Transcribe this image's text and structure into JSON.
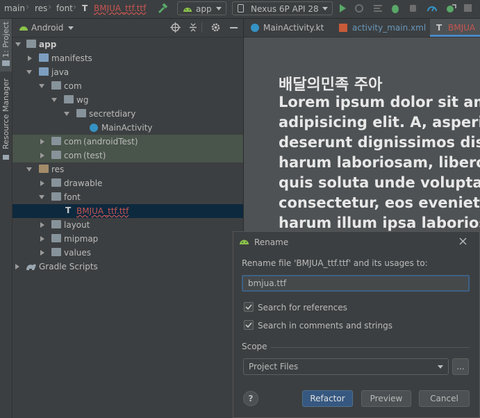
{
  "breadcrumb": {
    "items": [
      "main",
      "res",
      "font",
      "BMJUA_ttf.ttf"
    ]
  },
  "toolbar": {
    "run_config": "app",
    "device": "Nexus 6P API 28"
  },
  "left_strip": {
    "project_label": "1: Project",
    "resource_manager_label": "Resource Manager"
  },
  "project_panel": {
    "view_mode": "Android",
    "tree": [
      {
        "label": "app",
        "bold": true
      },
      {
        "label": "manifests"
      },
      {
        "label": "java"
      },
      {
        "label": "com"
      },
      {
        "label": "wg"
      },
      {
        "label": "secretdiary"
      },
      {
        "label": "MainActivity"
      },
      {
        "label": "com",
        "suffix": "(androidTest)"
      },
      {
        "label": "com",
        "suffix": "(test)"
      },
      {
        "label": "res"
      },
      {
        "label": "drawable"
      },
      {
        "label": "font"
      },
      {
        "label": "BMJUA_ttf.ttf"
      },
      {
        "label": "layout"
      },
      {
        "label": "mipmap"
      },
      {
        "label": "values"
      },
      {
        "label": "Gradle Scripts"
      }
    ]
  },
  "editor_tabs": [
    {
      "label": "MainActivity.kt"
    },
    {
      "label": "activity_main.xml"
    },
    {
      "label": "BMJUA"
    }
  ],
  "font_preview": {
    "title": "배달의민족 주아",
    "lines": [
      "Lorem ipsum dolor sit ame",
      "adipisicing elit. A, asperio",
      "deserunt dignissimos distin",
      "harum laboriosam, libero",
      "quis soluta unde voluptat",
      "consectetur, eos evenieti",
      "harum illum ipsa laboriosa"
    ]
  },
  "rename_dialog": {
    "title": "Rename",
    "prompt": "Rename file 'BMJUA_ttf.ttf' and its usages to:",
    "new_name": "bmjua.ttf",
    "search_references_label": "Search for references",
    "search_comments_label": "Search in comments and strings",
    "scope_label": "Scope",
    "scope_value": "Project Files",
    "browse_label": "...",
    "help_label": "?",
    "refactor_label": "Refactor",
    "preview_label": "Preview",
    "cancel_label": "Cancel"
  }
}
